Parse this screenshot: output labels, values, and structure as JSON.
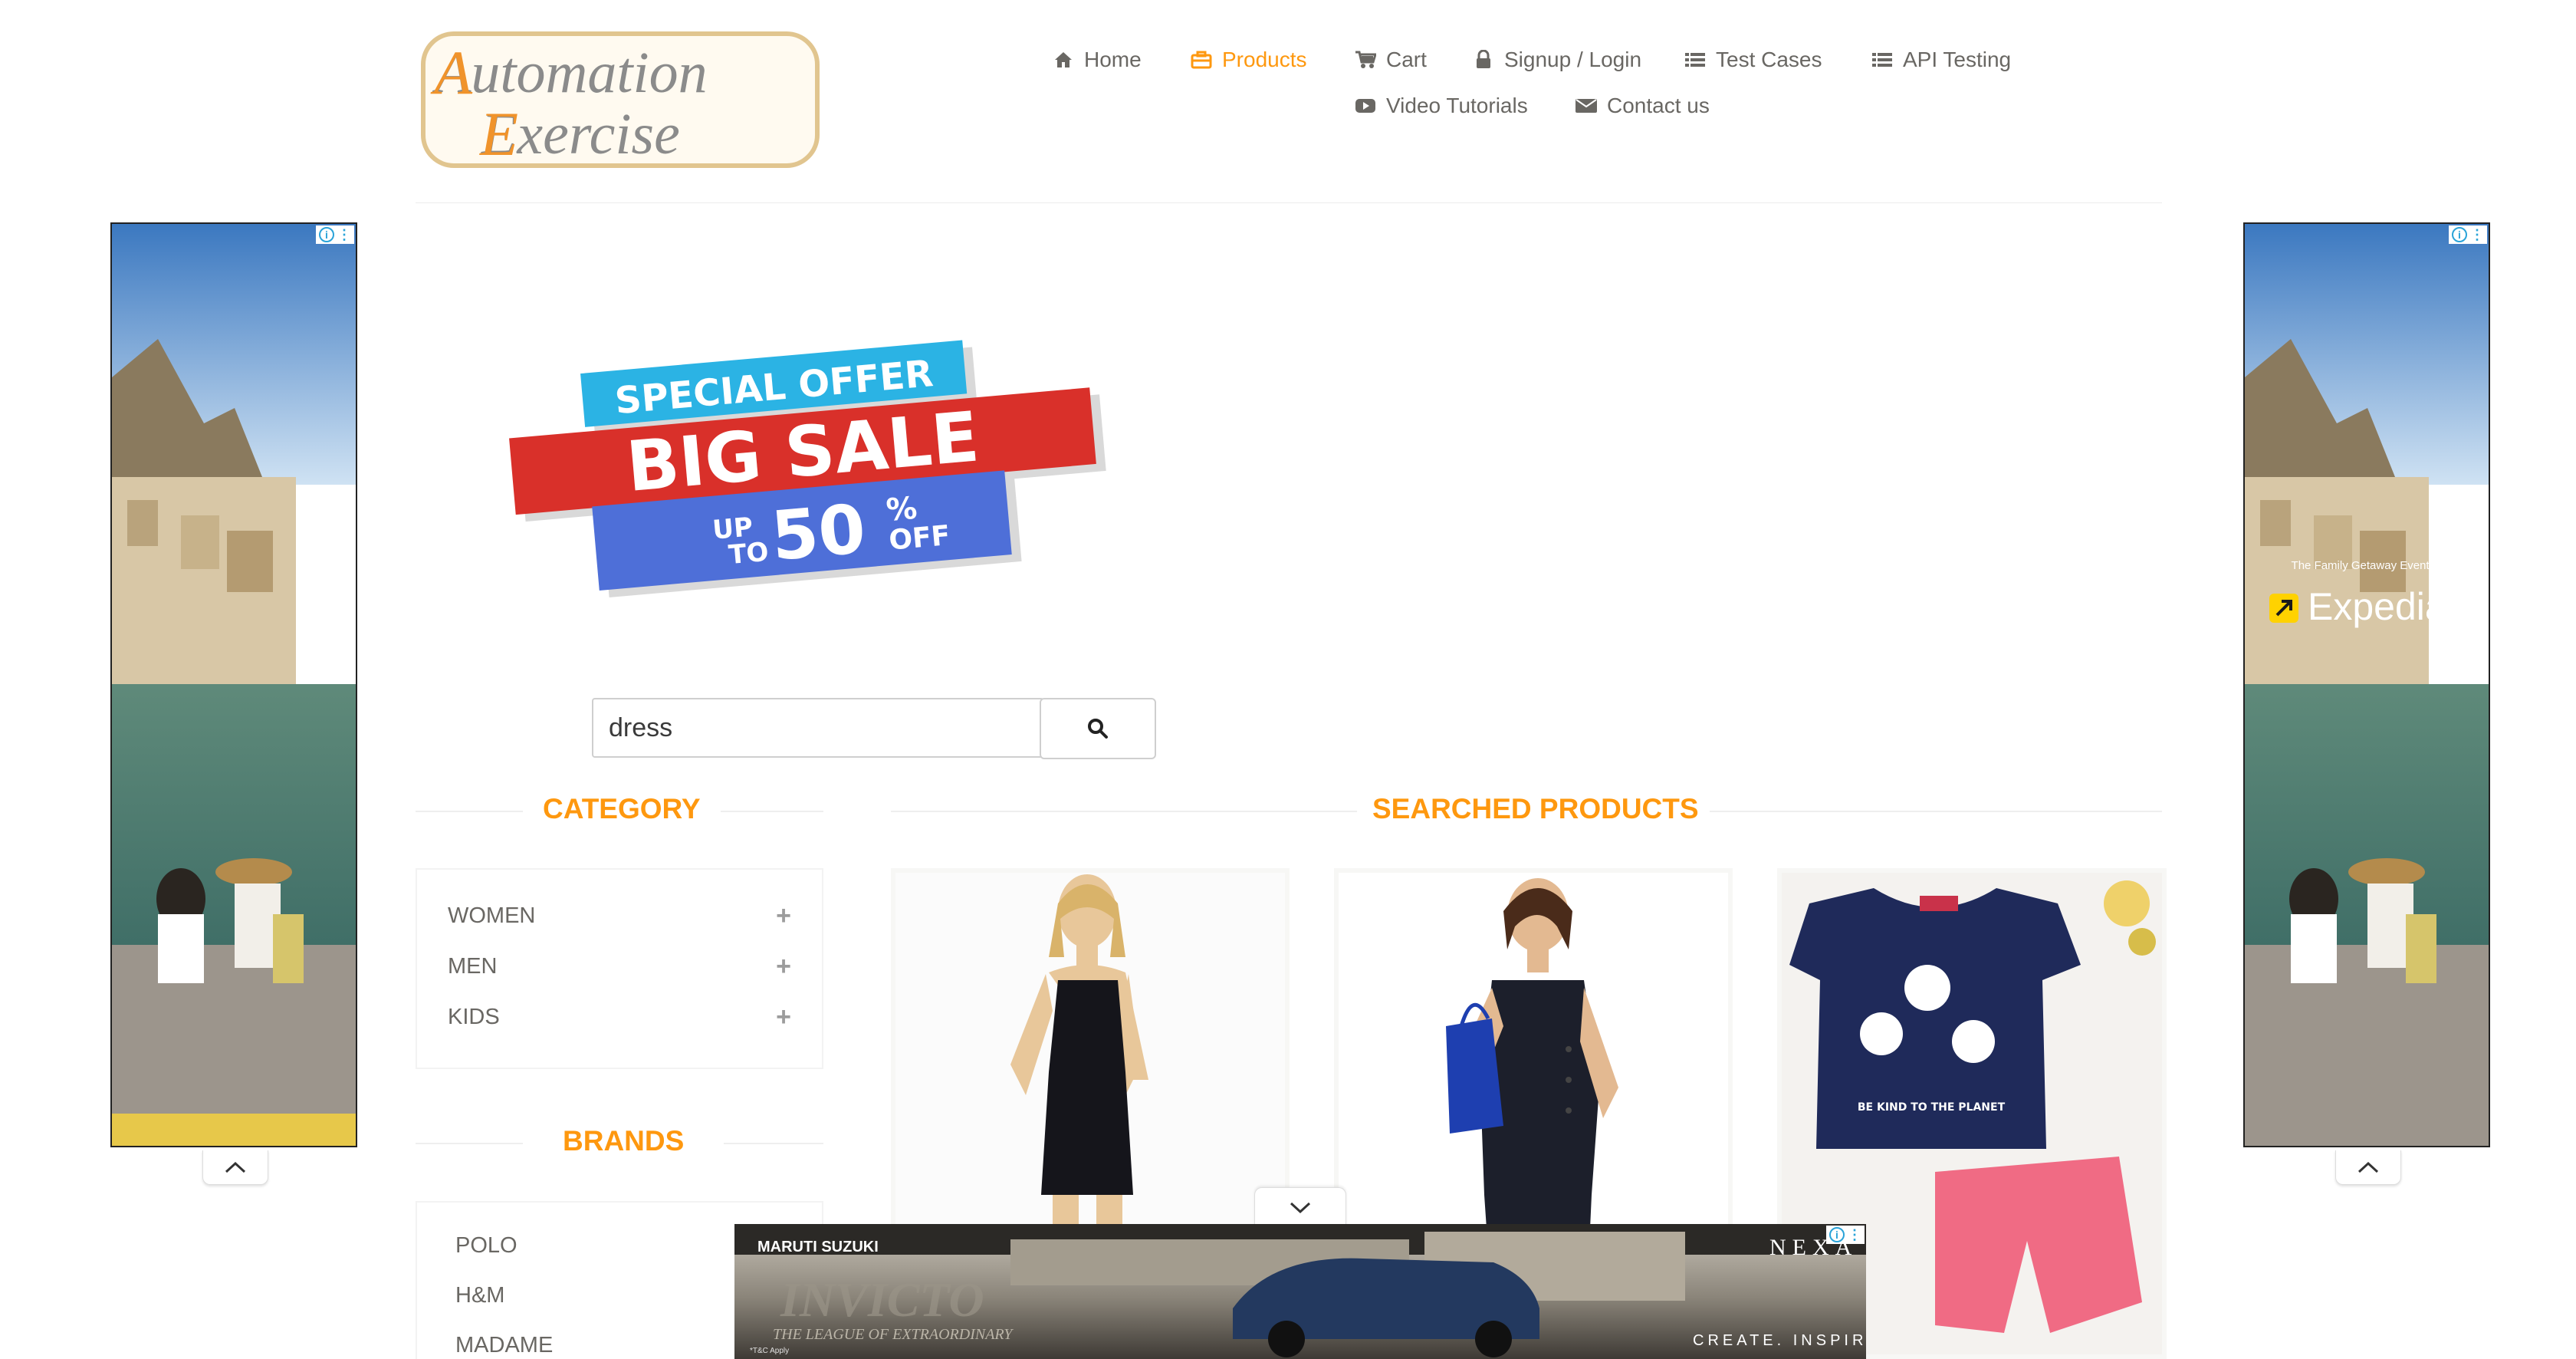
{
  "logo": {
    "line1": "Automation",
    "line2": "Exercise"
  },
  "nav": {
    "home": "Home",
    "products": "Products",
    "cart": "Cart",
    "signup_login": "Signup / Login",
    "test_cases": "Test Cases",
    "api_testing": "API Testing",
    "video_tutorials": "Video Tutorials",
    "contact_us": "Contact us"
  },
  "colors": {
    "accent": "#FE980F",
    "text": "#696763",
    "banner_red": "#D9302A",
    "banner_cyan": "#2BB3E4",
    "banner_blue": "#4E6FD8"
  },
  "banner": {
    "line1": "SPECIAL OFFER",
    "line2": "BIG SALE",
    "up": "UP",
    "to": "TO",
    "percent_value": "50",
    "percent_sign": "%",
    "off": "OFF"
  },
  "search": {
    "value": "dress",
    "icon": "search-icon"
  },
  "category": {
    "title": "CATEGORY",
    "items": [
      {
        "label": "WOMEN",
        "icon": "plus-icon"
      },
      {
        "label": "MEN",
        "icon": "plus-icon"
      },
      {
        "label": "KIDS",
        "icon": "plus-icon"
      }
    ]
  },
  "brands": {
    "title": "BRANDS",
    "items": [
      "POLO",
      "H&M",
      "MADAME"
    ]
  },
  "products": {
    "title": "SEARCHED PRODUCTS"
  },
  "ads": {
    "side_text_small": "The Family Getaway Event on",
    "side_brand": "Expedia",
    "bottom_brand": "MARUTI SUZUKI",
    "bottom_model": "INVICTO",
    "bottom_tagline": "THE LEAGUE OF EXTRAORDINARY",
    "bottom_nexa": "NEXA",
    "bottom_create": "CREATE. INSPIRE.",
    "bottom_fine": "*T&C Apply"
  }
}
